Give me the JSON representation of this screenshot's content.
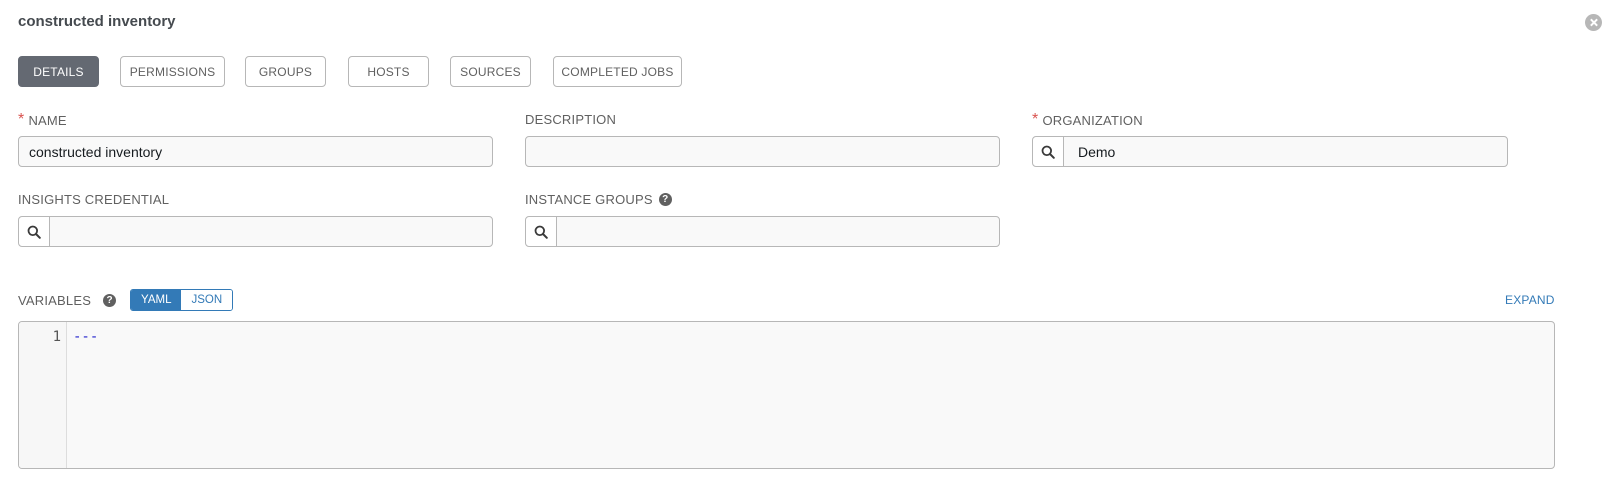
{
  "header": {
    "title": "constructed inventory"
  },
  "tabs": [
    {
      "label": "DETAILS"
    },
    {
      "label": "PERMISSIONS"
    },
    {
      "label": "GROUPS"
    },
    {
      "label": "HOSTS"
    },
    {
      "label": "SOURCES"
    },
    {
      "label": "COMPLETED JOBS"
    }
  ],
  "form": {
    "name": {
      "label": "NAME",
      "value": "constructed inventory",
      "required_mark": "*"
    },
    "description": {
      "label": "DESCRIPTION",
      "value": ""
    },
    "organization": {
      "label": "ORGANIZATION",
      "value": "Demo",
      "required_mark": "*"
    },
    "insights_credential": {
      "label": "INSIGHTS CREDENTIAL",
      "value": ""
    },
    "instance_groups": {
      "label": "INSTANCE GROUPS",
      "value": "",
      "help": "?"
    }
  },
  "variables": {
    "label": "VARIABLES",
    "help": "?",
    "modes": [
      "YAML",
      "JSON"
    ],
    "active_mode": "YAML",
    "expand_label": "EXPAND",
    "line_numbers": [
      "1"
    ],
    "code_lines": [
      "---"
    ]
  },
  "colors": {
    "active_tab": "#646972",
    "accent": "#337ab7",
    "required": "#d9534f"
  }
}
